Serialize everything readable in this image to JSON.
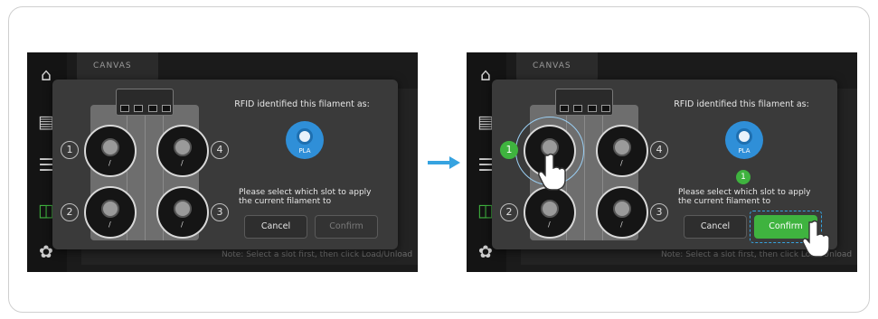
{
  "left_screen": {
    "tab_label": "CANVAS",
    "note": "Note: Select a slot first, then click Load/Unload",
    "hub_label": "",
    "dialog": {
      "title": "RFID identified this filament as:",
      "filament_label": "PLA",
      "prompt": "Please select which slot to apply the current filament to",
      "cancel_label": "Cancel",
      "confirm_label": "Confirm"
    },
    "slots": [
      "1",
      "2",
      "3",
      "4"
    ]
  },
  "right_screen": {
    "tab_label": "CANVAS",
    "note": "Note: Select a slot first, then click Load/Unload",
    "dialog": {
      "title": "RFID identified this filament as:",
      "filament_label": "PLA",
      "selected_slot": "1",
      "prompt": "Please select which slot to apply the current filament to",
      "cancel_label": "Cancel",
      "confirm_label": "Confirm"
    },
    "slots": [
      "1",
      "2",
      "3",
      "4"
    ]
  },
  "colors": {
    "accent_green": "#3fb33f",
    "accent_blue": "#2f8fd8",
    "arrow_blue": "#36a3e0"
  }
}
